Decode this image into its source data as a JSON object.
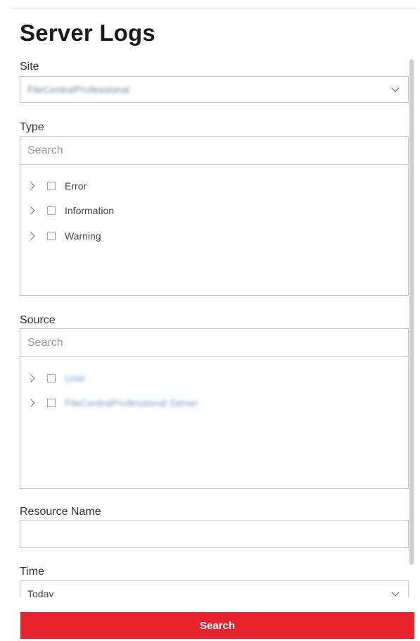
{
  "page": {
    "title": "Server Logs"
  },
  "site": {
    "label": "Site",
    "value": "FileCentralProfessional"
  },
  "type": {
    "label": "Type",
    "search_placeholder": "Search",
    "items": [
      {
        "label": "Error"
      },
      {
        "label": "Information"
      },
      {
        "label": "Warning"
      }
    ]
  },
  "source": {
    "label": "Source",
    "search_placeholder": "Search",
    "items": [
      {
        "label": "User"
      },
      {
        "label": "FileCentralProfessional Server"
      }
    ]
  },
  "resource": {
    "label": "Resource Name",
    "value": ""
  },
  "time": {
    "label": "Time",
    "value": "Today"
  },
  "actions": {
    "search_label": "Search"
  },
  "colors": {
    "accent": "#e8232b",
    "border": "#c8c8c8"
  }
}
